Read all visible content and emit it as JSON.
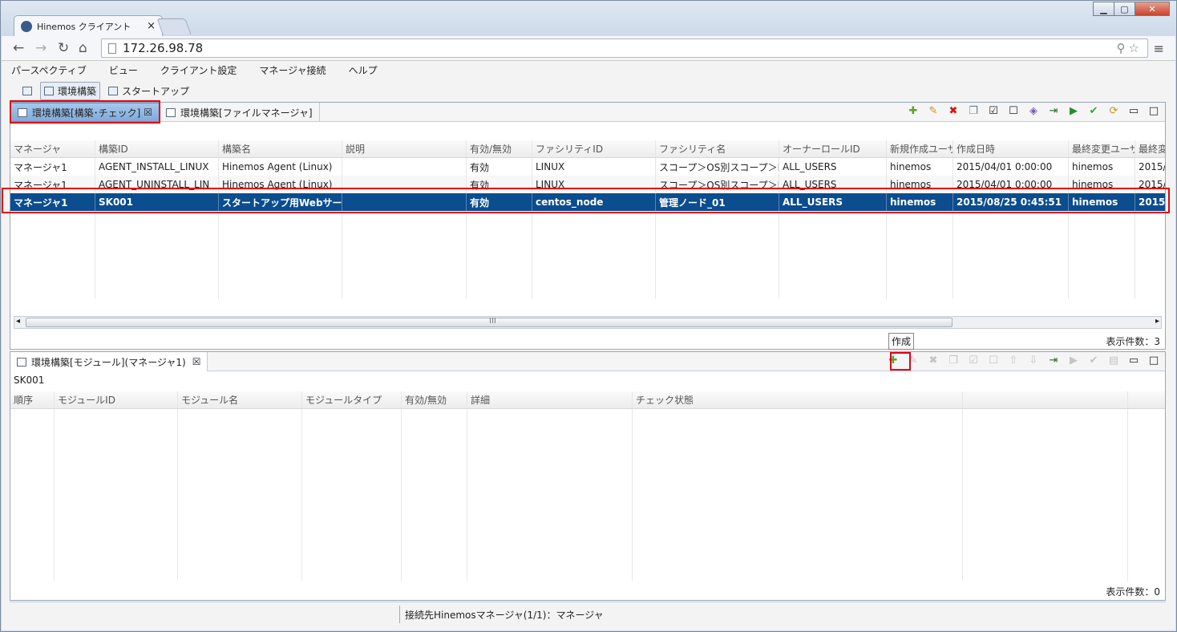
{
  "browser": {
    "tab_title": "Hinemos クライアント",
    "tab_close": "×",
    "url": "172.26.98.78"
  },
  "menu": [
    "パースペクティブ",
    "ビュー",
    "クライアント設定",
    "マネージャ接続",
    "ヘルプ"
  ],
  "perspectives": {
    "items": [
      "環境構築",
      "スタートアップ"
    ],
    "active": "環境構築"
  },
  "top_view": {
    "tabs": [
      "環境構築[構築･チェック]",
      "環境構築[ファイルマネージャ]"
    ],
    "close": "☒",
    "columns": [
      "マネージャ",
      "構築ID",
      "構築名",
      "説明",
      "有効/無効",
      "ファシリティID",
      "ファシリティ名",
      "オーナーロールID",
      "新規作成ユーザ",
      "作成日時",
      "最終変更ユーザ",
      "最終変更"
    ],
    "rows": [
      [
        "マネージャ1",
        "AGENT_INSTALL_LINUX",
        "Hinemos Agent (Linux)",
        "",
        "有効",
        "LINUX",
        "スコープ＞OS別スコープ＞Li",
        "ALL_USERS",
        "hinemos",
        "2015/04/01 0:00:00",
        "hinemos",
        "2015/"
      ],
      [
        "マネージャ1",
        "AGENT_UNINSTALL_LIN",
        "Hinemos Agent (Linux)",
        "",
        "有効",
        "LINUX",
        "スコープ＞OS別スコープ＞Li",
        "ALL_USERS",
        "hinemos",
        "2015/04/01 0:00:00",
        "hinemos",
        "2015/"
      ],
      [
        "マネージャ1",
        "SK001",
        "スタートアップ用Webサーバ",
        "",
        "有効",
        "centos_node",
        "管理ノード_01",
        "ALL_USERS",
        "hinemos",
        "2015/08/25 0:45:51",
        "hinemos",
        "2015/"
      ]
    ],
    "selected_row_index": 2,
    "count_label": "表示件数：3",
    "scroll_thumb_label": "III"
  },
  "tooltip": "作成",
  "bottom_view": {
    "tab": "環境構築[モジュール](マネージャ1)",
    "close": "☒",
    "selected_id": "SK001",
    "columns": [
      "順序",
      "モジュールID",
      "モジュール名",
      "モジュールタイプ",
      "有効/無効",
      "詳細",
      "チェック状態",
      ""
    ],
    "count_label": "表示件数：0"
  },
  "status_bar": {
    "text": "接続先Hinemosマネージャ(1/1)：マネージャ"
  },
  "colors": {
    "selection": "#0b4d8e",
    "highlight_box": "#e60012",
    "add_icon": "#5aa02c"
  }
}
